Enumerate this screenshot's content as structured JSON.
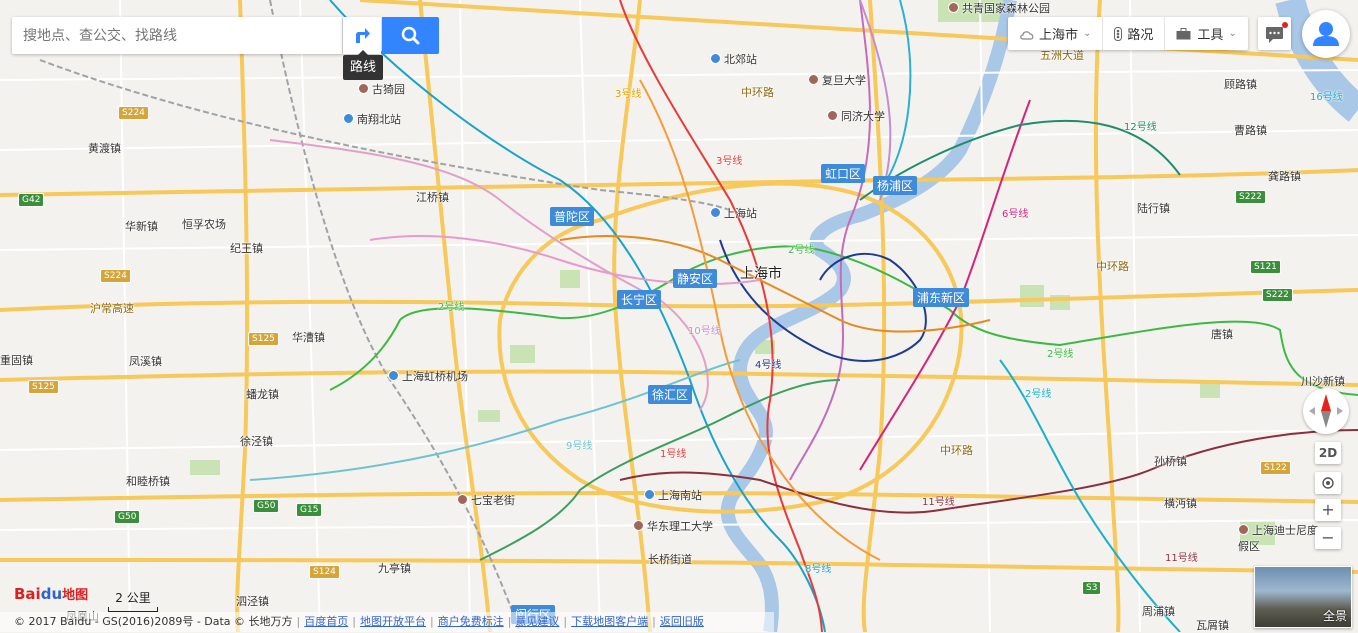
{
  "search": {
    "placeholder": "搜地点、查公交、找路线"
  },
  "route_tip": "路线",
  "toolbar": {
    "city": "上海市",
    "traffic": "路况",
    "tools": "工具"
  },
  "controls": {
    "mode_2d": "2D",
    "zoom_in": "+",
    "zoom_out": "−",
    "panorama": "全景"
  },
  "scale": "2 公里",
  "logo": {
    "bai": "Bai",
    "du": "du",
    "map": "地图"
  },
  "footer": {
    "copyright": "© 2017 Baidu - GS(2016)2089号 - Data © 长地万方",
    "links": [
      "百度首页",
      "地图开放平台",
      "商户免费标注",
      "意见建议",
      "下载地图客户端",
      "返回旧版"
    ]
  },
  "city_label": "上海市",
  "districts": [
    "普陀区",
    "虹口区",
    "杨浦区",
    "静安区",
    "长宁区",
    "浦东新区",
    "徐汇区",
    "闵行区"
  ],
  "towns": [
    "黄渡镇",
    "江桥镇",
    "华新镇",
    "恒孚农场",
    "纪王镇",
    "华漕镇",
    "凤溪镇",
    "重固镇",
    "蟠龙镇",
    "徐泾镇",
    "和睦桥镇",
    "九亭镇",
    "泗泾镇",
    "凤凰山",
    "陆行镇",
    "唐镇",
    "川沙新镇",
    "孙桥镇",
    "横沔镇",
    "周浦镇",
    "瓦屑镇",
    "顾路镇",
    "曹路镇",
    "龚路镇",
    "长桥街道"
  ],
  "pois": [
    "古猗园",
    "南翔北站",
    "北郊站",
    "复旦大学",
    "同济大学",
    "上海站",
    "上海虹桥机场",
    "七宝老街",
    "上海南站",
    "华东理工大学",
    "上海迪士尼度假区",
    "共青国家森林公园"
  ],
  "roads": [
    "中环路",
    "中环路",
    "中环路",
    "沪常高速",
    "五洲大道"
  ],
  "metro_lines": [
    "2号线",
    "2号线",
    "2号线",
    "3号线",
    "4号线",
    "6号线",
    "8号线",
    "9号线",
    "10号线",
    "11号线",
    "11号线",
    "12号线",
    "16号线",
    "1号线",
    "2号线",
    "3号线"
  ],
  "shields": [
    "S224",
    "G42",
    "S224",
    "S125",
    "S125",
    "G50",
    "G50",
    "G15",
    "S124",
    "S3",
    "S121",
    "S222",
    "S222",
    "S122"
  ],
  "colors": {
    "accent": "#3385ff",
    "district": "#3d8bd9",
    "road": "#f7c85a",
    "water": "#a9c8e8"
  }
}
